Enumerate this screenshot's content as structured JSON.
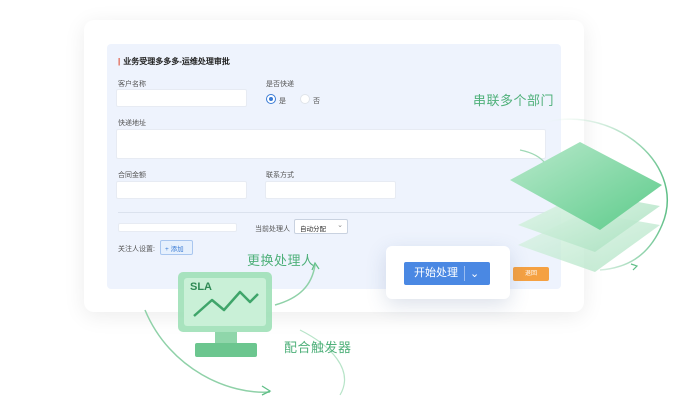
{
  "form": {
    "title": "业务受理多多多-运维处理审批",
    "customer_name_label": "客户名称",
    "express_label": "是否快递",
    "radio_yes": "是",
    "radio_no": "否",
    "address_label": "快递地址",
    "contract_amount_label": "合同金额",
    "contact_label": "联系方式",
    "current_handler_label": "当前处理人",
    "current_handler_value": "自动分配",
    "watcher_label": "关注人设置:",
    "add_label": "+ 添加",
    "return_label": "退回"
  },
  "popup": {
    "start_label": "开始处理"
  },
  "captions": {
    "multi_dept": "串联多个部门",
    "change_handler": "更换处理人",
    "trigger": "配合触发器"
  },
  "sla": {
    "text": "SLA"
  },
  "colors": {
    "accent_blue": "#4a88e3",
    "accent_green": "#4fb07a",
    "orange": "#f5a142"
  }
}
